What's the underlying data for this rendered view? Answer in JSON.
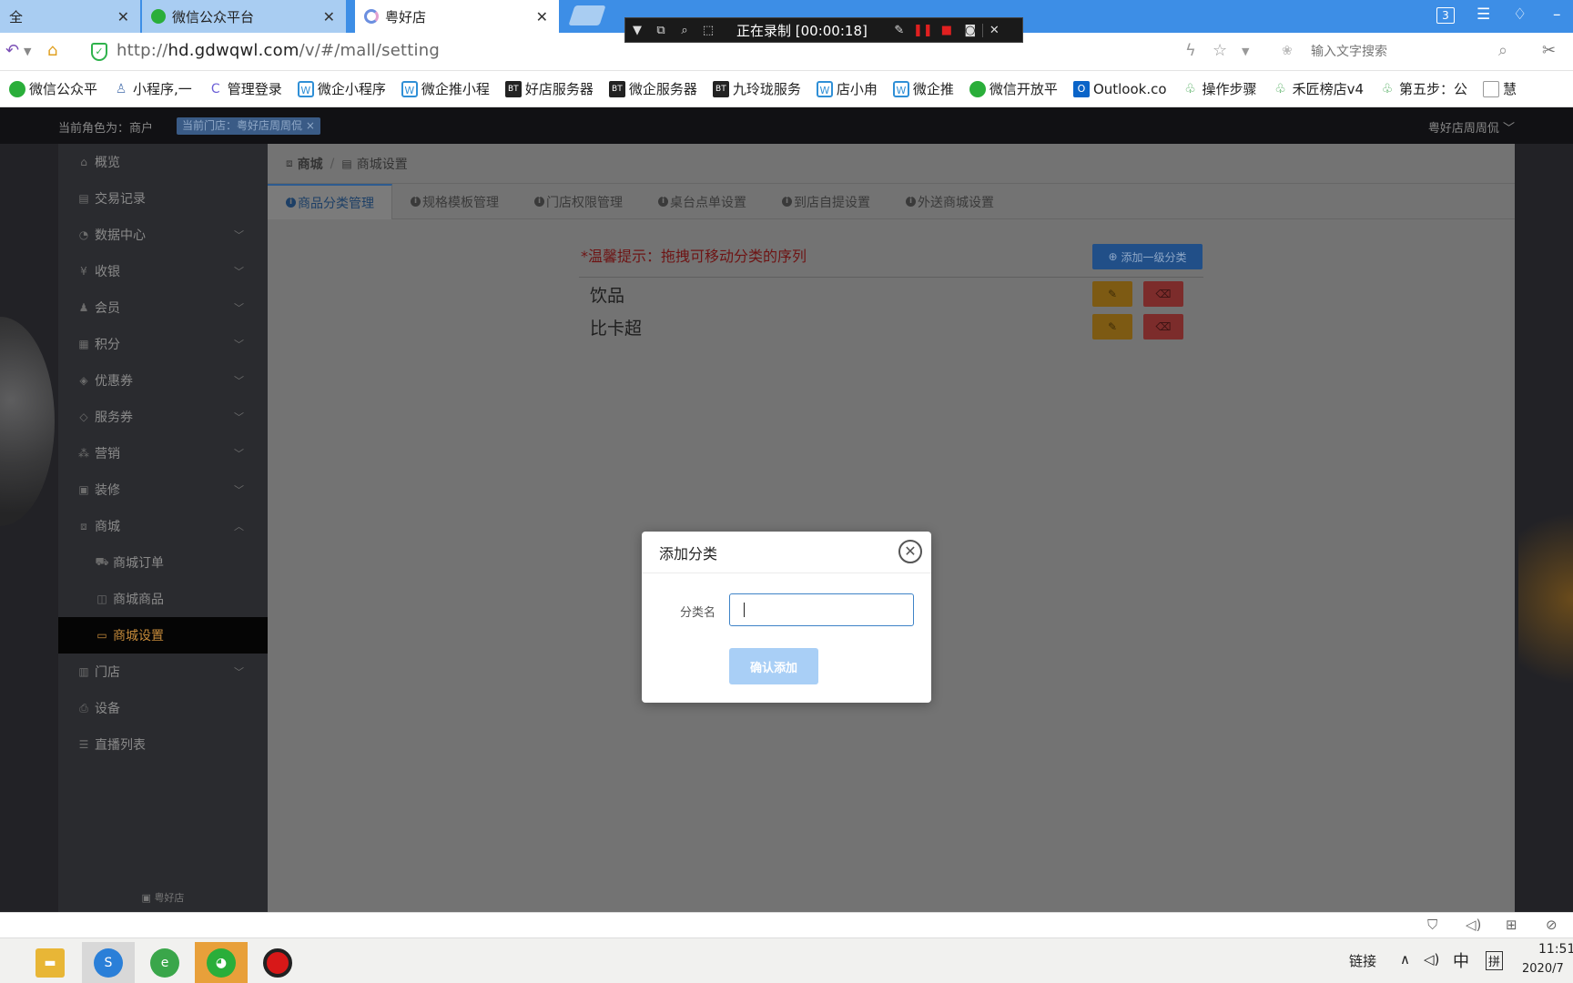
{
  "tabs": [
    {
      "title": "全",
      "active": false,
      "favicon": "none"
    },
    {
      "title": "微信公众平台",
      "active": false,
      "favicon": "wechat-icon"
    },
    {
      "title": "粤好店",
      "active": true,
      "favicon": "loading-icon"
    }
  ],
  "window_badge": "3",
  "recorder": {
    "text": "正在录制 [00:00:18]"
  },
  "address": {
    "url_prefix": "http://",
    "url_host": "hd.gdwqwl.com",
    "url_path": "/v/#/mall/setting"
  },
  "search": {
    "placeholder": "输入文字搜索"
  },
  "bookmarks": [
    {
      "label": "微信公众平",
      "icon": "wechat-icon",
      "color": "#2aae3a"
    },
    {
      "label": "小程序,一",
      "icon": "miniprogram-icon",
      "color": "#5b7fb5"
    },
    {
      "label": "管理登录",
      "icon": "c-logo-icon",
      "color": "#6b5fd6"
    },
    {
      "label": "微企小程序",
      "icon": "wq-icon",
      "color": "#2f8fd6"
    },
    {
      "label": "微企推小程",
      "icon": "wq-icon",
      "color": "#2f8fd6"
    },
    {
      "label": "好店服务器",
      "icon": "bt-icon",
      "color": "#222222"
    },
    {
      "label": "微企服务器",
      "icon": "bt-icon",
      "color": "#222222"
    },
    {
      "label": "九玲珑服务",
      "icon": "bt-icon",
      "color": "#222222"
    },
    {
      "label": "店小甪",
      "icon": "wq-icon",
      "color": "#2f8fd6"
    },
    {
      "label": "微企推",
      "icon": "wq-icon",
      "color": "#2f8fd6"
    },
    {
      "label": "微信开放平",
      "icon": "wechat-icon",
      "color": "#2aae3a"
    },
    {
      "label": "Outlook.co",
      "icon": "outlook-icon",
      "color": "#0a64c8"
    },
    {
      "label": "操作步骤",
      "icon": "leaf-icon",
      "color": "#3aa24a"
    },
    {
      "label": "禾匠榜店v4",
      "icon": "leaf-icon",
      "color": "#3aa24a"
    },
    {
      "label": "第五步：公",
      "icon": "leaf-icon",
      "color": "#3aa24a"
    },
    {
      "label": "慧",
      "icon": "page-icon",
      "color": "#999999"
    }
  ],
  "topnav": {
    "role": "当前角色为：商户",
    "store_tag": "当前门店：粤好店周周侃",
    "store_tag_close": "×",
    "user": "粤好店周周侃"
  },
  "sidebar": {
    "items": [
      {
        "label": "概览",
        "icon": "home-icon",
        "chevron": false
      },
      {
        "label": "交易记录",
        "icon": "receipt-icon",
        "chevron": false
      },
      {
        "label": "数据中心",
        "icon": "chart-icon",
        "chevron": true
      },
      {
        "label": "收银",
        "icon": "cashier-icon",
        "chevron": true
      },
      {
        "label": "会员",
        "icon": "member-icon",
        "chevron": true
      },
      {
        "label": "积分",
        "icon": "points-icon",
        "chevron": true
      },
      {
        "label": "优惠券",
        "icon": "coupon-icon",
        "chevron": true
      },
      {
        "label": "服务券",
        "icon": "ticket-icon",
        "chevron": true
      },
      {
        "label": "营销",
        "icon": "marketing-icon",
        "chevron": true
      },
      {
        "label": "装修",
        "icon": "decorate-icon",
        "chevron": true
      },
      {
        "label": "商城",
        "icon": "mall-icon",
        "chevron": true,
        "expanded": true
      }
    ],
    "sub_items": [
      {
        "label": "商城订单",
        "icon": "cart-icon"
      },
      {
        "label": "商城商品",
        "icon": "bag-icon"
      },
      {
        "label": "商城设置",
        "icon": "store-icon",
        "active": true
      }
    ],
    "items_after": [
      {
        "label": "门店",
        "icon": "shop-icon",
        "chevron": true
      },
      {
        "label": "设备",
        "icon": "printer-icon",
        "chevron": false
      },
      {
        "label": "直播列表",
        "icon": "list-icon",
        "chevron": false
      }
    ],
    "footer": "粤好店"
  },
  "breadcrumb": {
    "root": "商城",
    "sep": "/",
    "current": "商城设置"
  },
  "settings_tabs": [
    {
      "label": "商品分类管理",
      "active": true
    },
    {
      "label": "规格模板管理"
    },
    {
      "label": "门店权限管理"
    },
    {
      "label": "桌台点单设置"
    },
    {
      "label": "到店自提设置"
    },
    {
      "label": "外送商城设置"
    }
  ],
  "tip": "*温馨提示：拖拽可移动分类的序列",
  "add_top_button": "添加一级分类",
  "categories": [
    {
      "name": "饮品"
    },
    {
      "name": "比卡超"
    }
  ],
  "modal": {
    "title": "添加分类",
    "field_label": "分类名",
    "field_value": "",
    "submit_label": "确认添加"
  },
  "taskbar": {
    "tray_link": "链接",
    "ime_lang": "中",
    "ime_mode": "拼",
    "time": "11:51",
    "date": "2020/7"
  },
  "colors": {
    "accent": "#3e83c7",
    "sidebar_active": "#c58a3a",
    "tip_red": "#6e1414",
    "edit": "#7d5a13",
    "delete": "#7c2c2b"
  }
}
